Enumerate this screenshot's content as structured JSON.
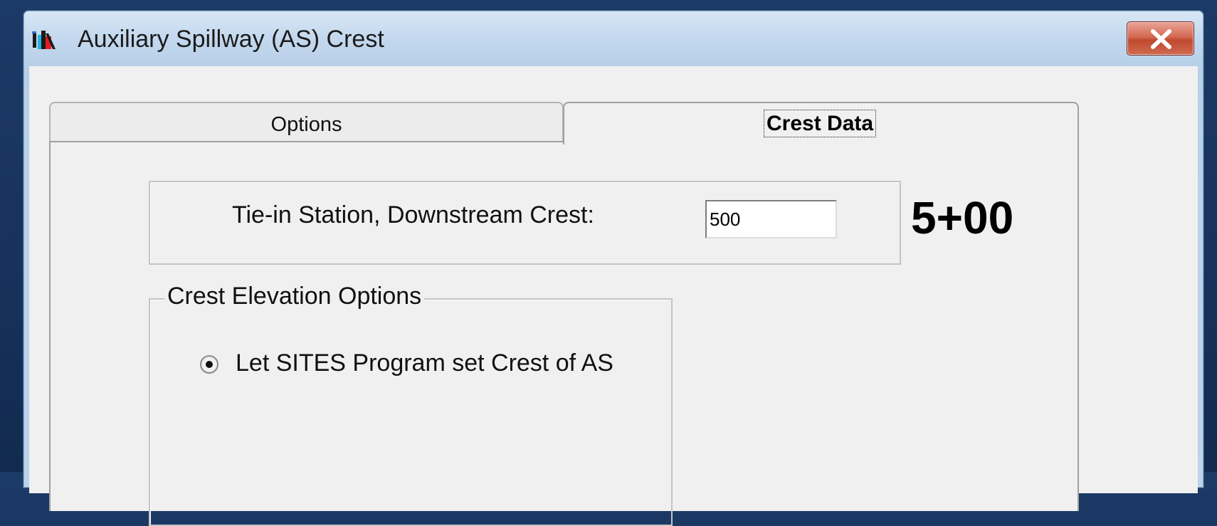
{
  "window": {
    "title": "Auxiliary Spillway (AS) Crest",
    "close_icon": "close-x-icon",
    "app_icon": "sites-app-icon"
  },
  "tabs": [
    {
      "label": "Options",
      "selected": false
    },
    {
      "label": "Crest Data",
      "selected": true
    }
  ],
  "tie_in": {
    "label": "Tie-in Station, Downstream Crest:",
    "value": "500"
  },
  "annotation": {
    "text": "5+00"
  },
  "crest_elevation": {
    "legend": "Crest Elevation Options",
    "options": [
      {
        "label": "Let SITES Program set Crest of AS",
        "selected": true
      }
    ]
  },
  "colors": {
    "background": "#17325c",
    "client": "#f0f0f0",
    "close_button": "#c8553e"
  }
}
